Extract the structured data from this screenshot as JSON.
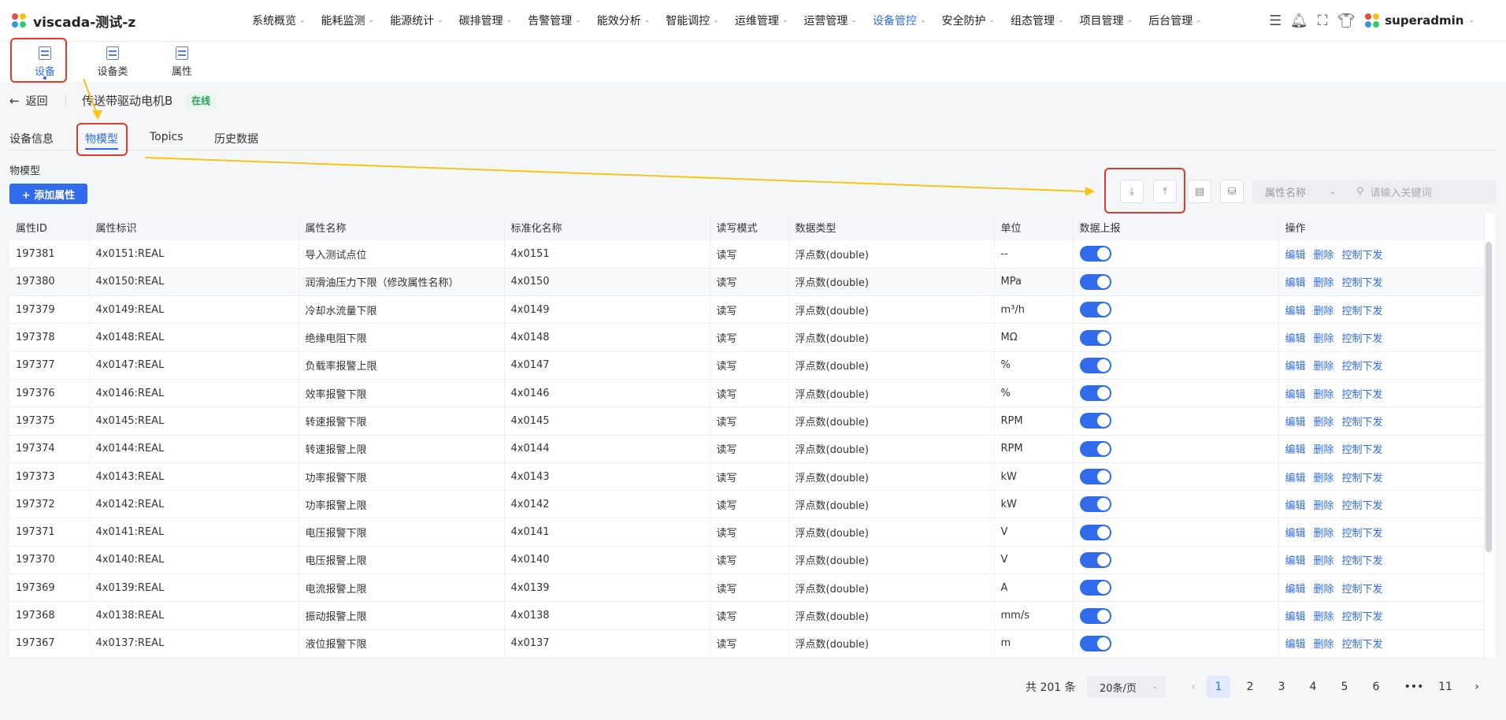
{
  "app": {
    "title": "viscada-测试-z"
  },
  "nav": {
    "items": [
      {
        "label": "系统概览",
        "active": false
      },
      {
        "label": "能耗监测",
        "active": false
      },
      {
        "label": "能源统计",
        "active": false
      },
      {
        "label": "碳排管理",
        "active": false
      },
      {
        "label": "告警管理",
        "active": false
      },
      {
        "label": "能效分析",
        "active": false
      },
      {
        "label": "智能调控",
        "active": false
      },
      {
        "label": "运维管理",
        "active": false
      },
      {
        "label": "运营管理",
        "active": false
      },
      {
        "label": "设备管控",
        "active": true
      },
      {
        "label": "安全防护",
        "active": false
      },
      {
        "label": "组态管理",
        "active": false
      },
      {
        "label": "项目管理",
        "active": false
      },
      {
        "label": "后台管理",
        "active": false
      }
    ]
  },
  "user": {
    "name": "superadmin"
  },
  "subnav": {
    "items": [
      {
        "label": "设备",
        "active": true
      },
      {
        "label": "设备类",
        "active": false
      },
      {
        "label": "属性",
        "active": false
      }
    ]
  },
  "header": {
    "back_label": "返回",
    "device_name": "传送带驱动电机B",
    "status": "在线"
  },
  "tabs": [
    "设备信息",
    "物模型",
    "Topics",
    "历史数据"
  ],
  "section": {
    "title": "物模型",
    "add_button": "+ 添加属性"
  },
  "filter": {
    "select_value": "属性名称",
    "search_placeholder": "请输入关键词"
  },
  "table": {
    "columns": [
      "属性ID",
      "属性标识",
      "属性名称",
      "标准化名称",
      "读写模式",
      "数据类型",
      "单位",
      "数据上报",
      "操作"
    ],
    "ops": [
      "编辑",
      "删除",
      "控制下发"
    ],
    "rows": [
      {
        "id": "197381",
        "key": "4x0151:REAL",
        "name": "导入测试点位",
        "std": "4x0151",
        "rw": "读写",
        "type": "浮点数(double)",
        "unit": "--",
        "report": true
      },
      {
        "id": "197380",
        "key": "4x0150:REAL",
        "name": "润滑油压力下限（修改属性名称）",
        "std": "4x0150",
        "rw": "读写",
        "type": "浮点数(double)",
        "unit": "MPa",
        "report": true
      },
      {
        "id": "197379",
        "key": "4x0149:REAL",
        "name": "冷却水流量下限",
        "std": "4x0149",
        "rw": "读写",
        "type": "浮点数(double)",
        "unit": "m³/h",
        "report": true
      },
      {
        "id": "197378",
        "key": "4x0148:REAL",
        "name": "绝缘电阻下限",
        "std": "4x0148",
        "rw": "读写",
        "type": "浮点数(double)",
        "unit": "MΩ",
        "report": true
      },
      {
        "id": "197377",
        "key": "4x0147:REAL",
        "name": "负载率报警上限",
        "std": "4x0147",
        "rw": "读写",
        "type": "浮点数(double)",
        "unit": "%",
        "report": true
      },
      {
        "id": "197376",
        "key": "4x0146:REAL",
        "name": "效率报警下限",
        "std": "4x0146",
        "rw": "读写",
        "type": "浮点数(double)",
        "unit": "%",
        "report": true
      },
      {
        "id": "197375",
        "key": "4x0145:REAL",
        "name": "转速报警下限",
        "std": "4x0145",
        "rw": "读写",
        "type": "浮点数(double)",
        "unit": "RPM",
        "report": true
      },
      {
        "id": "197374",
        "key": "4x0144:REAL",
        "name": "转速报警上限",
        "std": "4x0144",
        "rw": "读写",
        "type": "浮点数(double)",
        "unit": "RPM",
        "report": true
      },
      {
        "id": "197373",
        "key": "4x0143:REAL",
        "name": "功率报警下限",
        "std": "4x0143",
        "rw": "读写",
        "type": "浮点数(double)",
        "unit": "kW",
        "report": true
      },
      {
        "id": "197372",
        "key": "4x0142:REAL",
        "name": "功率报警上限",
        "std": "4x0142",
        "rw": "读写",
        "type": "浮点数(double)",
        "unit": "kW",
        "report": true
      },
      {
        "id": "197371",
        "key": "4x0141:REAL",
        "name": "电压报警下限",
        "std": "4x0141",
        "rw": "读写",
        "type": "浮点数(double)",
        "unit": "V",
        "report": true
      },
      {
        "id": "197370",
        "key": "4x0140:REAL",
        "name": "电压报警上限",
        "std": "4x0140",
        "rw": "读写",
        "type": "浮点数(double)",
        "unit": "V",
        "report": true
      },
      {
        "id": "197369",
        "key": "4x0139:REAL",
        "name": "电流报警上限",
        "std": "4x0139",
        "rw": "读写",
        "type": "浮点数(double)",
        "unit": "A",
        "report": true
      },
      {
        "id": "197368",
        "key": "4x0138:REAL",
        "name": "振动报警上限",
        "std": "4x0138",
        "rw": "读写",
        "type": "浮点数(double)",
        "unit": "mm/s",
        "report": true
      },
      {
        "id": "197367",
        "key": "4x0137:REAL",
        "name": "液位报警下限",
        "std": "4x0137",
        "rw": "读写",
        "type": "浮点数(double)",
        "unit": "m",
        "report": true
      }
    ]
  },
  "pagination": {
    "total": "共 201 条",
    "page_size": "20条/页",
    "pages": [
      "1",
      "2",
      "3",
      "4",
      "5",
      "6",
      "•••",
      "11"
    ],
    "current": "1"
  },
  "colors": {
    "accent": "#2f6bea",
    "annotation_red": "#e03b2a",
    "annotation_arrow": "#f5c518",
    "status_green": "#27a05a"
  }
}
